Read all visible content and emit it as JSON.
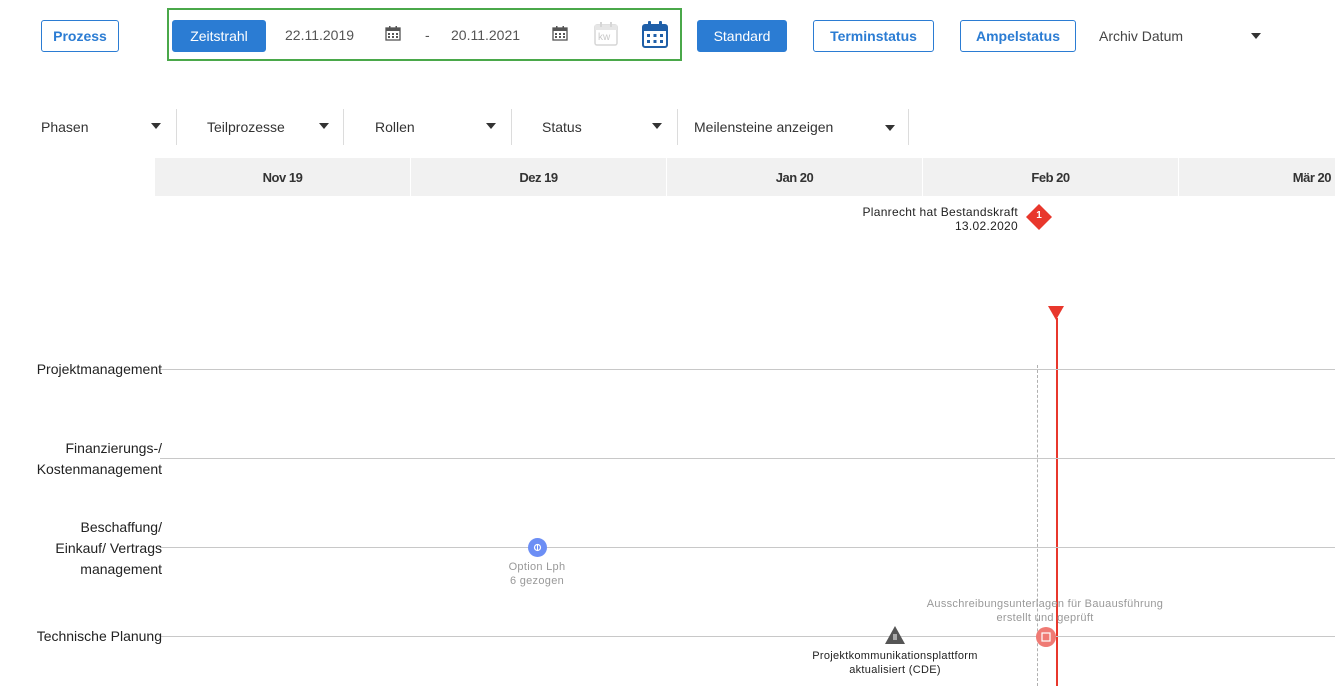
{
  "toolbar": {
    "prozess_label": "Prozess",
    "zeitstrahl_label": "Zeitstrahl",
    "date_from": "22.11.2019",
    "date_separator": "-",
    "date_to": "20.11.2021",
    "kw_label": "kw",
    "standard_label": "Standard",
    "terminstatus_label": "Terminstatus",
    "ampelstatus_label": "Ampelstatus",
    "archiv_label": "Archiv Datum"
  },
  "filters": {
    "phasen": "Phasen",
    "teilprozesse": "Teilprozesse",
    "rollen": "Rollen",
    "status": "Status",
    "meilensteine": "Meilensteine anzeigen"
  },
  "timeline": {
    "months": [
      "Nov 19",
      "Dez 19",
      "Jan 20",
      "Feb 20",
      "Mär 20"
    ]
  },
  "milestones": {
    "planrecht_line1": "Planrecht hat Bestandskraft",
    "planrecht_line2": "13.02.2020",
    "planrecht_badge": "1",
    "option_line1": "Option Lph",
    "option_line2": "6 gezogen",
    "ausschreibung_line1": "Ausschreibungsunterlagen für Bauausführung",
    "ausschreibung_line2": "erstellt und geprüft",
    "projektkomm_line1": "Projektkommunikationsplattform",
    "projektkomm_line2": "aktualisiert (CDE)"
  },
  "rows": {
    "projektmanagement": "Projektmanagement",
    "finanzierung_line1": "Finanzierungs-/",
    "finanzierung_line2": "Kostenmanagement",
    "beschaffung_line1": "Beschaffung/",
    "beschaffung_line2": "Einkauf/ Vertrags",
    "beschaffung_line3": "management",
    "technische": "Technische Planung"
  },
  "colors": {
    "accent": "#2b7cd3",
    "highlight_box": "#4aa84a",
    "today_line": "#e8372c",
    "milestone_red": "#e8372c",
    "option_marker": "#6c8ef5"
  }
}
